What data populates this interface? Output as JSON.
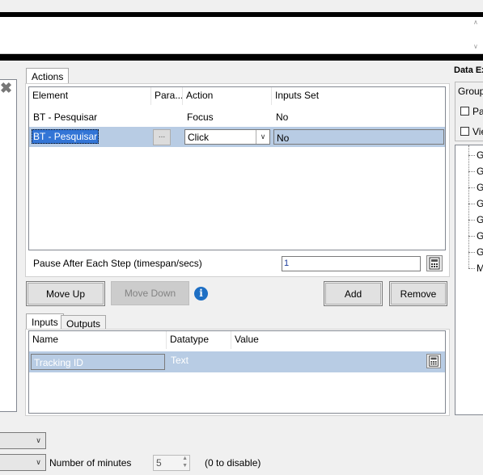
{
  "actions_panel": {
    "tab_label": "Actions",
    "columns": [
      "Element",
      "Para...",
      "Action",
      "Inputs Set"
    ],
    "rows": [
      {
        "element": "BT - Pesquisar",
        "params": "",
        "action": "Focus",
        "inputs_set": "No"
      },
      {
        "element": "BT - Pesquisar",
        "params": "...",
        "action": "Click",
        "inputs_set": "No"
      }
    ],
    "pause_label": "Pause After Each Step (timespan/secs)",
    "pause_value": "1"
  },
  "buttons": {
    "move_up": "Move Up",
    "move_down": "Move Down",
    "add": "Add",
    "remove": "Remove"
  },
  "io_panel": {
    "tabs": [
      "Inputs",
      "Outputs"
    ],
    "columns": [
      "Name",
      "Datatype",
      "Value"
    ],
    "rows": [
      {
        "name": "Tracking ID",
        "datatype": "Text",
        "value": ""
      }
    ]
  },
  "right_panel": {
    "title": "Data Ex",
    "group_label": "Group",
    "checkbox1": "Pag",
    "checkbox2": "Vie",
    "tree_items": [
      "G",
      "G",
      "G",
      "G",
      "G",
      "G",
      "G",
      "M"
    ]
  },
  "bottom": {
    "minutes_label": "Number of minutes",
    "minutes_value": "5",
    "hint": "(0 to disable)"
  },
  "colors": {
    "selection": "#b8cce4",
    "info_icon": "#1e6fc4"
  }
}
